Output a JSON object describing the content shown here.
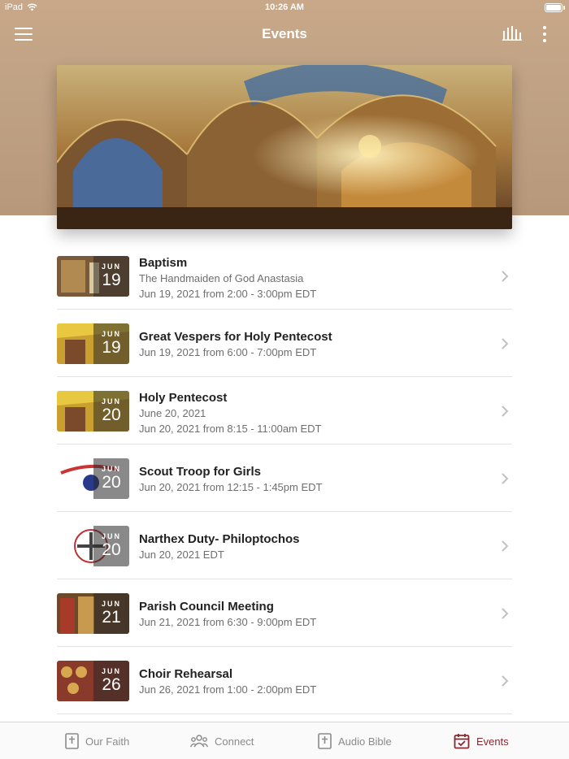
{
  "status_bar": {
    "device": "iPad",
    "time": "10:26 AM"
  },
  "nav": {
    "title": "Events",
    "menu_icon": "hamburger-menu-icon",
    "chart_icon": "bar-chart-icon",
    "more_icon": "more-vertical-icon"
  },
  "colors": {
    "header_tan": "#c8a888",
    "accent": "#8a2830",
    "muted_text": "#6e6e6e"
  },
  "events": [
    {
      "month": "JUN",
      "day": "19",
      "title": "Baptism",
      "line1": "The Handmaiden of God Anastasia",
      "line2": "Jun 19, 2021 from 2:00 - 3:00pm EDT"
    },
    {
      "month": "JUN",
      "day": "19",
      "title": "Great Vespers for Holy Pentecost",
      "line1": "Jun 19, 2021 from 6:00 - 7:00pm EDT",
      "line2": ""
    },
    {
      "month": "JUN",
      "day": "20",
      "title": "Holy Pentecost",
      "line1": "June 20, 2021",
      "line2": "Jun 20, 2021 from 8:15 - 11:00am EDT"
    },
    {
      "month": "JUN",
      "day": "20",
      "title": "Scout Troop for Girls",
      "line1": "Jun 20, 2021 from 12:15 - 1:45pm EDT",
      "line2": ""
    },
    {
      "month": "JUN",
      "day": "20",
      "title": "Narthex Duty- Philoptochos",
      "line1": "Jun 20, 2021 EDT",
      "line2": ""
    },
    {
      "month": "JUN",
      "day": "21",
      "title": "Parish Council Meeting",
      "line1": "Jun 21, 2021 from 6:30 - 9:00pm EDT",
      "line2": ""
    },
    {
      "month": "JUN",
      "day": "26",
      "title": "Choir Rehearsal",
      "line1": "Jun 26, 2021 from 1:00 - 2:00pm EDT",
      "line2": ""
    }
  ],
  "tabs": [
    {
      "label": "Our Faith",
      "icon": "bible-cross-icon",
      "active": false
    },
    {
      "label": "Connect",
      "icon": "people-group-icon",
      "active": false
    },
    {
      "label": "Audio Bible",
      "icon": "bible-cross-icon",
      "active": false
    },
    {
      "label": "Events",
      "icon": "calendar-check-icon",
      "active": true
    }
  ]
}
